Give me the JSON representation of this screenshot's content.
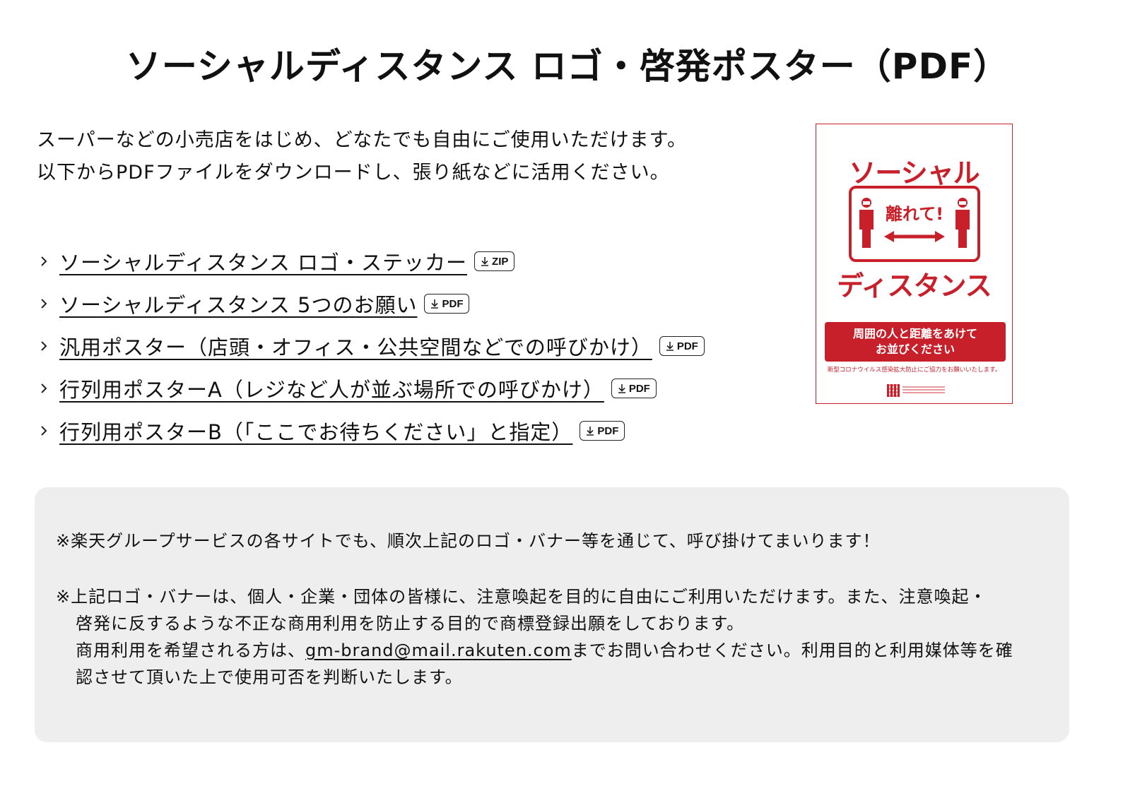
{
  "page": {
    "title": "ソーシャルディスタンス ロゴ・啓発ポスター（PDF）"
  },
  "intro": {
    "line1": "スーパーなどの小売店をはじめ、どなたでも自由にご使用いただけます。",
    "line2": "以下からPDFファイルをダウンロードし、張り紙などに活用ください。"
  },
  "downloads": [
    {
      "label": "ソーシャルディスタンス ロゴ・ステッカー",
      "badge": "ZIP",
      "icon": "download-icon"
    },
    {
      "label": "ソーシャルディスタンス 5つのお願い",
      "badge": "PDF",
      "icon": "download-icon"
    },
    {
      "label": "汎用ポスター（店頭・オフィス・公共空間などでの呼びかけ）",
      "badge": "PDF",
      "icon": "download-icon"
    },
    {
      "label": "行列用ポスターA（レジなど人が並ぶ場所での呼びかけ）",
      "badge": "PDF",
      "icon": "download-icon"
    },
    {
      "label": "行列用ポスターB（「ここでお待ちください」と指定）",
      "badge": "PDF",
      "icon": "download-icon"
    }
  ],
  "poster": {
    "title_top": "ソーシャル",
    "box_text": "離れて!",
    "title_bottom": "ディスタンス",
    "banner_line1": "周囲の人と距離をあけて",
    "banner_line2": "お並びください",
    "note": "新型コロナウイルス感染拡大防止にご協力をお願いいたします。",
    "accent_color": "#c8202b"
  },
  "notice": {
    "line1": "※楽天グループサービスの各サイトでも、順次上記のロゴ・バナー等を通じて、呼び掛けてまいります！",
    "line2": "※上記ロゴ・バナーは、個人・企業・団体の皆様に、注意喚起を目的に自由にご利用いただけます。また、注意喚起・",
    "line3": "啓発に反するような不正な商用利用を防止する目的で商標登録出願をしております。",
    "line4_before": "商用利用を希望される方は、",
    "email": "gm-brand@mail.rakuten.com",
    "line4_after": "までお問い合わせください。利用目的と利用媒体等を確",
    "line5": "認させて頂いた上で使用可否を判断いたします。",
    "background": "#eeeeee"
  }
}
